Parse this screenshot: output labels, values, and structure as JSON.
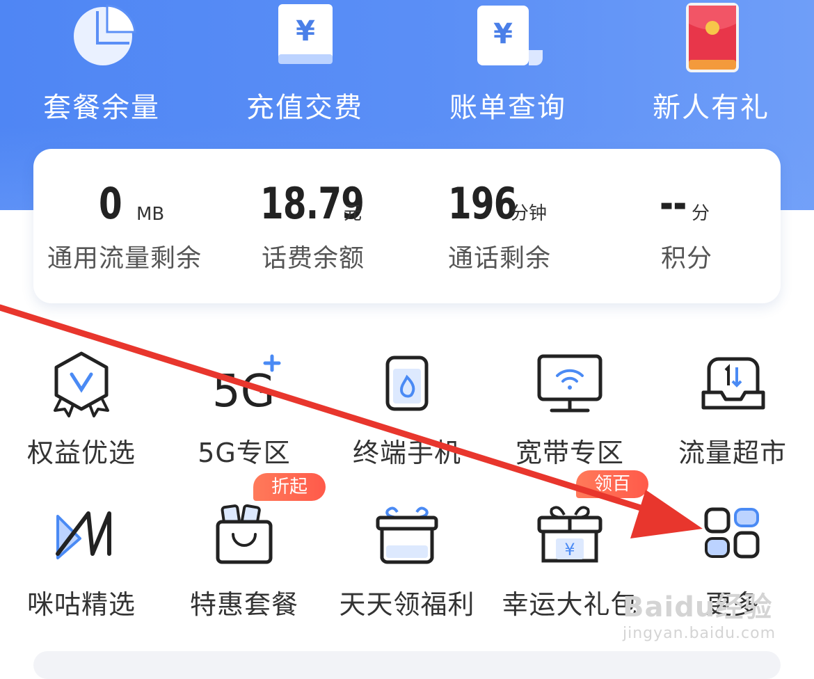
{
  "quick_actions": [
    {
      "label": "套餐余量",
      "icon": "pie-chart-icon"
    },
    {
      "label": "充值交费",
      "icon": "yuan-card-icon"
    },
    {
      "label": "账单查询",
      "icon": "yuan-bill-icon"
    },
    {
      "label": "新人有礼",
      "icon": "red-envelope-icon"
    }
  ],
  "stats": [
    {
      "value": "0",
      "unit": "MB",
      "label": "通用流量剩余"
    },
    {
      "value": "18.79",
      "unit": "元",
      "label": "话费余额"
    },
    {
      "value": "196",
      "unit": "分钟",
      "label": "通话剩余"
    },
    {
      "value": "--",
      "unit": "分",
      "label": "积分"
    }
  ],
  "services_row1": [
    {
      "label": "权益优选",
      "icon": "vip-badge-icon"
    },
    {
      "label": "5G专区",
      "icon": "5g-plus-icon"
    },
    {
      "label": "终端手机",
      "icon": "phone-icon"
    },
    {
      "label": "宽带专区",
      "icon": "wifi-monitor-icon"
    },
    {
      "label": "流量超市",
      "icon": "data-box-icon"
    }
  ],
  "services_row2": [
    {
      "label": "咪咕精选",
      "icon": "migu-icon"
    },
    {
      "label": "特惠套餐",
      "icon": "shopping-bag-icon",
      "badge": "折起"
    },
    {
      "label": "天天领福利",
      "icon": "gift-box-icon"
    },
    {
      "label": "幸运大礼包",
      "icon": "yuan-gift-icon",
      "badge": "领百元"
    },
    {
      "label": "更多",
      "icon": "more-grid-icon"
    }
  ],
  "watermark": {
    "brand": "Baidu经验",
    "url": "jingyan.baidu.com"
  },
  "colors": {
    "header_blue": "#4f86f4",
    "icon_blue": "#4a8af4",
    "arrow_red": "#e8362d",
    "badge_red": "#ff5a4a"
  }
}
